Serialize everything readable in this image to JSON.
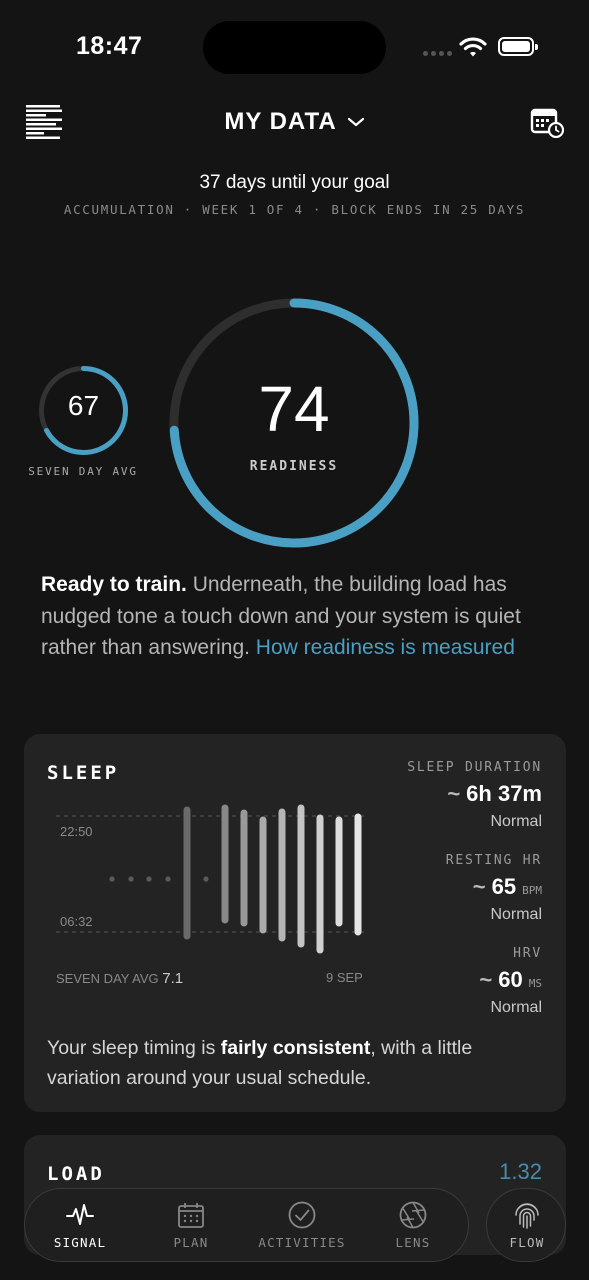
{
  "status_bar": {
    "time": "18:47"
  },
  "header": {
    "title": "MY DATA"
  },
  "goal": {
    "headline": "37 days until your goal",
    "block_line": "ACCUMULATION · WEEK 1 OF 4 · BLOCK ENDS IN 25 DAYS"
  },
  "readiness": {
    "seven_day_avg_value": "67",
    "seven_day_avg_label": "SEVEN DAY AVG",
    "seven_day_avg_fraction": 0.67,
    "value": "74",
    "label": "READINESS",
    "fraction": 0.74,
    "accent_color": "#4a9fc4"
  },
  "summary": {
    "lead": "Ready to train.",
    "body": " Underneath, the building load has nudged tone a touch down and your system is quiet rather than answering. ",
    "link": "How readiness is measured"
  },
  "sleep": {
    "title": "SLEEP",
    "chart_labels": {
      "top_time": "22:50",
      "bottom_time": "06:32"
    },
    "footer_left_label": "SEVEN DAY AVG",
    "footer_left_value": "7.1",
    "footer_right": "9 SEP",
    "duration": {
      "label": "SLEEP DURATION",
      "value": "6h 37m",
      "status": "Normal"
    },
    "resting_hr": {
      "label": "RESTING HR",
      "value": "65",
      "unit": "BPM",
      "status": "Normal"
    },
    "hrv": {
      "label": "HRV",
      "value": "60",
      "unit": "MS",
      "status": "Normal"
    },
    "note_pre": "Your sleep timing is ",
    "note_bold": "fairly consistent",
    "note_post": ", with a little variation around your usual schedule."
  },
  "load": {
    "title": "LOAD",
    "value": "1.32"
  },
  "tabs": [
    {
      "label": "SIGNAL",
      "icon": "pulse-icon",
      "active": true
    },
    {
      "label": "PLAN",
      "icon": "calendar-icon",
      "active": false
    },
    {
      "label": "ACTIVITIES",
      "icon": "check-circle-icon",
      "active": false
    },
    {
      "label": "LENS",
      "icon": "aperture-icon",
      "active": false
    }
  ],
  "flow": {
    "label": "FLOW",
    "icon": "fingerprint-icon"
  }
}
